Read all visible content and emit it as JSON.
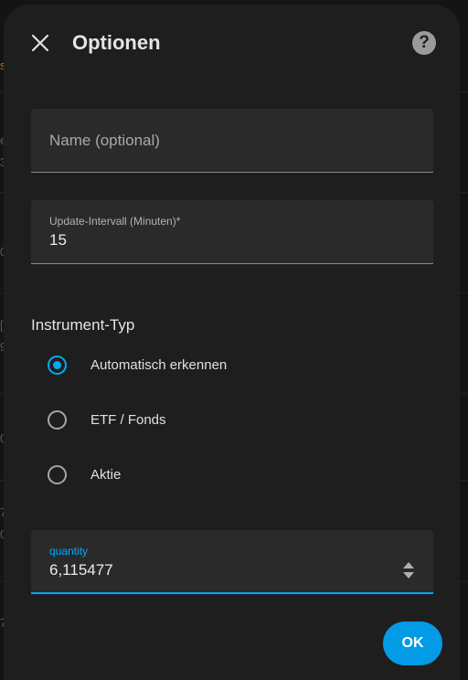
{
  "dialog": {
    "title": "Optionen",
    "close_icon": "close-icon",
    "help_icon": "help-circle-icon",
    "help_symbol": "?"
  },
  "name_field": {
    "placeholder": "Name (optional)",
    "value": ""
  },
  "update_interval": {
    "label": "Update-Intervall (Minuten)*",
    "value": "15"
  },
  "instrument_type": {
    "title": "Instrument-Typ",
    "options": [
      {
        "label": "Automatisch erkennen",
        "checked": true
      },
      {
        "label": "ETF / Fonds",
        "checked": false
      },
      {
        "label": "Aktie",
        "checked": false
      }
    ]
  },
  "quantity": {
    "label": "quantity",
    "value": "6,115477",
    "stepper_icon": "number-stepper-icon"
  },
  "actions": {
    "ok_label": "OK"
  },
  "colors": {
    "accent": "#03a9f4",
    "dialog_background": "#1e1e1e",
    "field_background": "#2a2a2a"
  },
  "background_glyphs": [
    "s",
    "e",
    "3",
    "0",
    "[",
    "9",
    "0",
    "7",
    "0",
    "7"
  ]
}
